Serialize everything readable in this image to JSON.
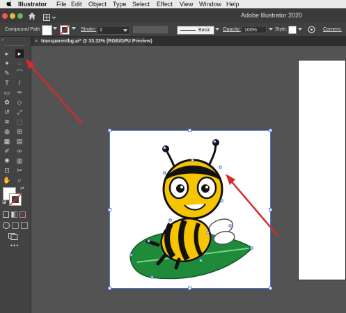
{
  "menubar": {
    "app_name": "Illustrator",
    "items": [
      "File",
      "Edit",
      "Object",
      "Type",
      "Select",
      "Effect",
      "View",
      "Window",
      "Help"
    ]
  },
  "titlebar": {
    "title": "Adobe Illustrator 2020"
  },
  "control_bar": {
    "selection_type": "Compound Path",
    "stroke_label": "Stroke:",
    "brush_label": "Basic",
    "opacity_label": "Opacity:",
    "opacity_value": "100%",
    "style_label": "Style:",
    "corners_label": "Corners:"
  },
  "document_tab": {
    "close_glyph": "×",
    "title": "transparentbg.ai* @ 33.33% (RGB/GPU Preview)"
  },
  "tool_icons": [
    "selection-tool-icon",
    "direct-selection-tool-icon",
    "magic-wand-tool-icon",
    "lasso-tool-icon",
    "pen-tool-icon",
    "curvature-tool-icon",
    "type-tool-icon",
    "line-segment-tool-icon",
    "rectangle-tool-icon",
    "paintbrush-tool-icon",
    "shaper-tool-icon",
    "eraser-tool-icon",
    "rotate-tool-icon",
    "scale-tool-icon",
    "width-tool-icon",
    "free-transform-tool-icon",
    "shape-builder-tool-icon",
    "perspective-grid-tool-icon",
    "mesh-tool-icon",
    "gradient-tool-icon",
    "eyedropper-tool-icon",
    "blend-tool-icon",
    "symbol-sprayer-tool-icon",
    "column-graph-tool-icon",
    "artboard-tool-icon",
    "slice-tool-icon",
    "hand-tool-icon",
    "zoom-tool-icon"
  ],
  "colors": {
    "annotation_arrow": "#d42a2a",
    "selection": "#4a78d8",
    "bee_yellow": "#f6c400",
    "leaf_green": "#1f8a3a"
  }
}
